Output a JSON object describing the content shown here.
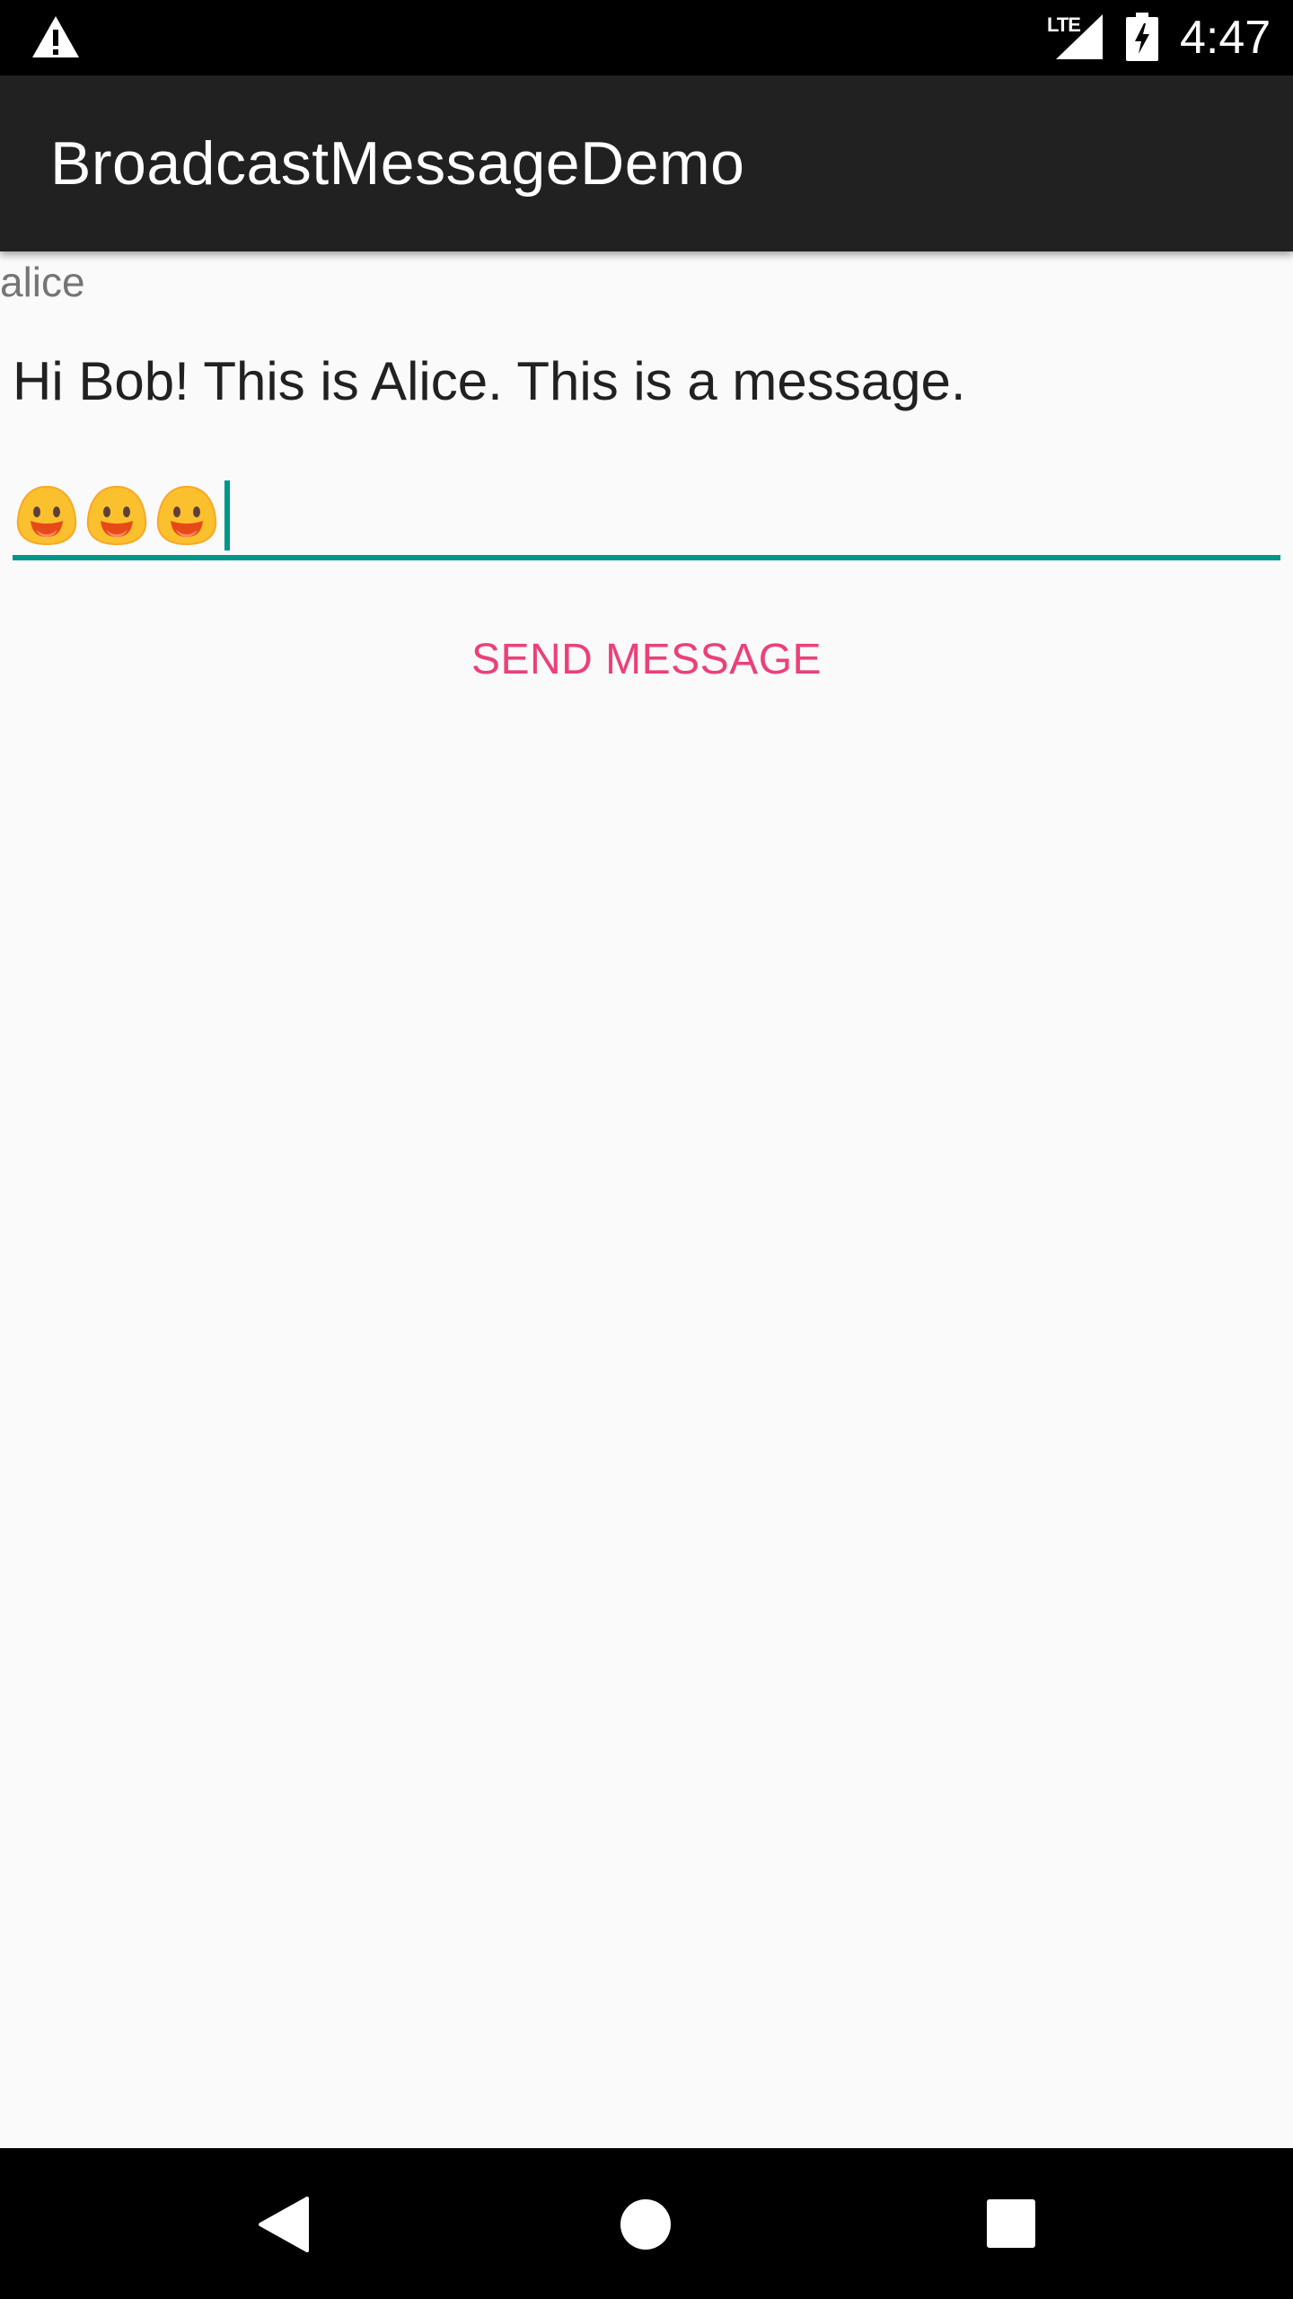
{
  "status_bar": {
    "network": "LTE",
    "time": "4:47",
    "icons": [
      "warning-icon",
      "signal-icon",
      "battery-charging-icon"
    ]
  },
  "app_bar": {
    "title": "BroadcastMessageDemo"
  },
  "content": {
    "username": "alice",
    "received_message": "Hi Bob! This is Alice. This is a message.",
    "message_input": {
      "value_emoji": [
        "grinning-face-emoji",
        "grinning-face-emoji",
        "grinning-face-emoji"
      ],
      "underline_color": "#009688"
    },
    "send_button_label": "SEND MESSAGE"
  },
  "nav_bar": {
    "icons": [
      "back-icon",
      "home-icon",
      "recents-icon"
    ]
  },
  "colors": {
    "status_bar": "#000000",
    "app_bar": "#212121",
    "background": "#fafafa",
    "accent": "#ec407a",
    "input_accent": "#009688"
  }
}
